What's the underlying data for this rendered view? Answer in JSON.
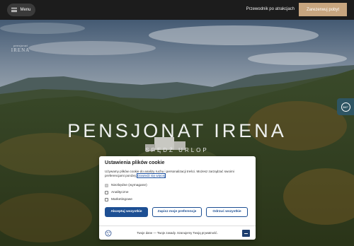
{
  "header": {
    "menu_label": "Menu",
    "guide_label": "Przewodnik po atrakcjach",
    "reserve_label": "Zarezerwuj pobyt"
  },
  "hero": {
    "logo_top": "pensjonat",
    "logo_main": "IRENA",
    "title": "PENSJONAT IRENA",
    "subtitle": "SPĘDŹ URLOP",
    "side_button_label": "360°"
  },
  "cookie": {
    "title": "Ustawienia plików cookie",
    "description": "Używamy plików cookie do analizy ruchu i personalizacji treści. Możesz zarządzać swoimi preferencjami poniżej.",
    "learn_more": "Dowiedz się więcej",
    "options": [
      {
        "label": "Niezbędne (wymagane)",
        "checked": true,
        "disabled": true
      },
      {
        "label": "Analityczne",
        "checked": false,
        "disabled": false
      },
      {
        "label": "Marketingowe",
        "checked": false,
        "disabled": false
      }
    ],
    "accept_all": "Akceptuj wszystkie",
    "save_prefs": "Zapisz moje preferencje",
    "reject_all": "Odrzuć wszystkie",
    "footer": "Twoje dane — Twoje zasady. Szanujemy Twoją prywatność."
  },
  "colors": {
    "topbar": "#1c1c1c",
    "reserve_button": "#c7a57f",
    "primary_blue": "#1d4f93",
    "side_button": "#2e5563"
  },
  "icons": {
    "menu": "hamburger-icon",
    "side": "panorama-360-icon",
    "cookie": "cookie-icon",
    "minimize": "minimize-icon"
  }
}
